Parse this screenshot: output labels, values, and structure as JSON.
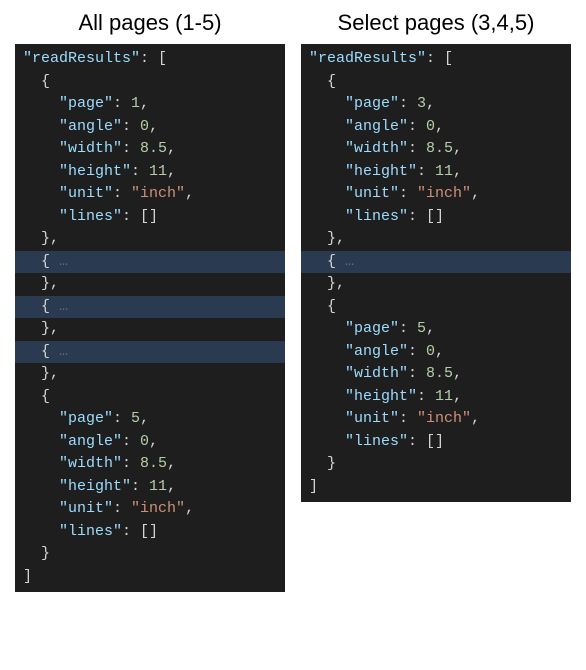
{
  "panels": [
    {
      "title": "All pages (1-5)",
      "rootKey": "readResults",
      "lines": [
        {
          "type": "root-open",
          "text": "\"readResults\": ["
        },
        {
          "type": "open",
          "indent": 1,
          "text": "{"
        },
        {
          "type": "kv",
          "indent": 2,
          "key": "page",
          "value": "1",
          "vtype": "number",
          "comma": true
        },
        {
          "type": "kv",
          "indent": 2,
          "key": "angle",
          "value": "0",
          "vtype": "number",
          "comma": true
        },
        {
          "type": "kv",
          "indent": 2,
          "key": "width",
          "value": "8.5",
          "vtype": "number",
          "comma": true
        },
        {
          "type": "kv",
          "indent": 2,
          "key": "height",
          "value": "11",
          "vtype": "number",
          "comma": true
        },
        {
          "type": "kv",
          "indent": 2,
          "key": "unit",
          "value": "\"inch\"",
          "vtype": "string",
          "comma": true
        },
        {
          "type": "kv",
          "indent": 2,
          "key": "lines",
          "value": "[]",
          "vtype": "punct",
          "comma": false
        },
        {
          "type": "close",
          "indent": 1,
          "text": "},"
        },
        {
          "type": "collapsed",
          "indent": 1,
          "text": "{"
        },
        {
          "type": "close",
          "indent": 1,
          "text": "},"
        },
        {
          "type": "collapsed",
          "indent": 1,
          "text": "{"
        },
        {
          "type": "close",
          "indent": 1,
          "text": "},"
        },
        {
          "type": "collapsed",
          "indent": 1,
          "text": "{"
        },
        {
          "type": "close",
          "indent": 1,
          "text": "},"
        },
        {
          "type": "open",
          "indent": 1,
          "text": "{"
        },
        {
          "type": "kv",
          "indent": 2,
          "key": "page",
          "value": "5",
          "vtype": "number",
          "comma": true
        },
        {
          "type": "kv",
          "indent": 2,
          "key": "angle",
          "value": "0",
          "vtype": "number",
          "comma": true
        },
        {
          "type": "kv",
          "indent": 2,
          "key": "width",
          "value": "8.5",
          "vtype": "number",
          "comma": true
        },
        {
          "type": "kv",
          "indent": 2,
          "key": "height",
          "value": "11",
          "vtype": "number",
          "comma": true
        },
        {
          "type": "kv",
          "indent": 2,
          "key": "unit",
          "value": "\"inch\"",
          "vtype": "string",
          "comma": true
        },
        {
          "type": "kv",
          "indent": 2,
          "key": "lines",
          "value": "[]",
          "vtype": "punct",
          "comma": false
        },
        {
          "type": "close",
          "indent": 1,
          "text": "}"
        },
        {
          "type": "close",
          "indent": 0,
          "text": "]"
        }
      ]
    },
    {
      "title": "Select pages (3,4,5)",
      "rootKey": "readResults",
      "lines": [
        {
          "type": "root-open",
          "text": "\"readResults\": ["
        },
        {
          "type": "open",
          "indent": 1,
          "text": "{"
        },
        {
          "type": "kv",
          "indent": 2,
          "key": "page",
          "value": "3",
          "vtype": "number",
          "comma": true
        },
        {
          "type": "kv",
          "indent": 2,
          "key": "angle",
          "value": "0",
          "vtype": "number",
          "comma": true
        },
        {
          "type": "kv",
          "indent": 2,
          "key": "width",
          "value": "8.5",
          "vtype": "number",
          "comma": true
        },
        {
          "type": "kv",
          "indent": 2,
          "key": "height",
          "value": "11",
          "vtype": "number",
          "comma": true
        },
        {
          "type": "kv",
          "indent": 2,
          "key": "unit",
          "value": "\"inch\"",
          "vtype": "string",
          "comma": true
        },
        {
          "type": "kv",
          "indent": 2,
          "key": "lines",
          "value": "[]",
          "vtype": "punct",
          "comma": false
        },
        {
          "type": "close",
          "indent": 1,
          "text": "},"
        },
        {
          "type": "collapsed",
          "indent": 1,
          "text": "{"
        },
        {
          "type": "close",
          "indent": 1,
          "text": "},"
        },
        {
          "type": "open",
          "indent": 1,
          "text": "{"
        },
        {
          "type": "kv",
          "indent": 2,
          "key": "page",
          "value": "5",
          "vtype": "number",
          "comma": true
        },
        {
          "type": "kv",
          "indent": 2,
          "key": "angle",
          "value": "0",
          "vtype": "number",
          "comma": true
        },
        {
          "type": "kv",
          "indent": 2,
          "key": "width",
          "value": "8.5",
          "vtype": "number",
          "comma": true
        },
        {
          "type": "kv",
          "indent": 2,
          "key": "height",
          "value": "11",
          "vtype": "number",
          "comma": true
        },
        {
          "type": "kv",
          "indent": 2,
          "key": "unit",
          "value": "\"inch\"",
          "vtype": "string",
          "comma": true
        },
        {
          "type": "kv",
          "indent": 2,
          "key": "lines",
          "value": "[]",
          "vtype": "punct",
          "comma": false
        },
        {
          "type": "close",
          "indent": 1,
          "text": "}"
        },
        {
          "type": "close",
          "indent": 0,
          "text": "]"
        }
      ]
    }
  ]
}
